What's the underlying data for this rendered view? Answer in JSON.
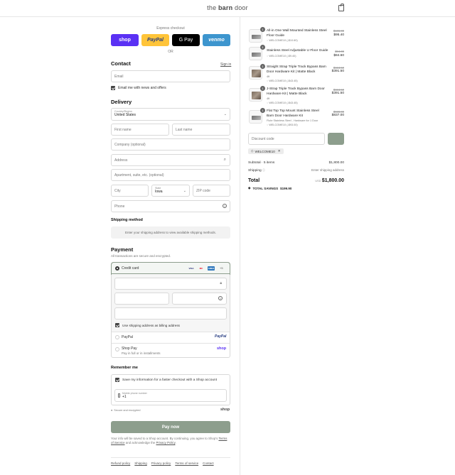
{
  "header": {
    "brand_pre": "the ",
    "brand_bold": "barn",
    "brand_post": " door",
    "cart_icon": "shopping-bag-icon"
  },
  "express": {
    "label": "Express checkout",
    "buttons": [
      "shop",
      "PayPal",
      "G Pay",
      "venmo"
    ],
    "or": "OR"
  },
  "contact": {
    "title": "Contact",
    "sign_in": "Sign in",
    "email_placeholder": "Email",
    "newsletter_label": "Email me with news and offers"
  },
  "delivery": {
    "title": "Delivery",
    "country_label": "Country/Region",
    "country_value": "United States",
    "first_name": "First name",
    "last_name": "Last name",
    "company": "Company (optional)",
    "address": "Address",
    "apartment": "Apartment, suite, etc. (optional)",
    "city": "City",
    "state_label": "State",
    "state_value": "Iowa",
    "zip": "ZIP code",
    "phone": "Phone"
  },
  "shipping_method": {
    "title": "Shipping method",
    "info": "Enter your shipping address to view available shipping methods."
  },
  "payment": {
    "title": "Payment",
    "subtitle": "All transactions are secure and encrypted.",
    "credit_card_label": "Credit card",
    "card_brands": [
      "VISA",
      "MC",
      "AMEX"
    ],
    "more_brands": "+5",
    "billing_same": "Use shipping address as billing address",
    "paypal_label": "PayPal",
    "paypal_logo": "PayPal",
    "shoppay_label": "Shop Pay",
    "shoppay_sub": "Pay in full or in installments",
    "shoppay_logo": "shop"
  },
  "remember": {
    "title": "Remember me",
    "save_label": "Save my information for a faster checkout with a Shop account",
    "phone_label": "Mobile phone number",
    "phone_value": "+1",
    "secure": "Secure and encrypted",
    "shop_logo": "shop"
  },
  "paynow": {
    "label": "Pay now"
  },
  "legal": {
    "line1": "Your info will be saved to a Shop account. By continuing, you agree to Shop's",
    "tos": "Terms of Service",
    "and": " and acknowledge the ",
    "privacy": "Privacy Policy",
    "end": "."
  },
  "footer": [
    "Refund policy",
    "Shipping",
    "Privacy policy",
    "Terms of service",
    "Contact"
  ],
  "cart": {
    "items": [
      {
        "qty": "1",
        "name": "All-in One Wall Mounted Stainless Steel Floor Guide",
        "variant": "",
        "discount": "WELCOME10 (-$10.60)",
        "old": "$106.00",
        "price": "$95.40"
      },
      {
        "qty": "1",
        "name": "Stainless Steel Adjustable U Floor Guide",
        "variant": "",
        "discount": "WELCOME10 (-$9.40)",
        "old": "$94.00",
        "price": "$84.60"
      },
      {
        "qty": "1",
        "name": "Straight Strap Triple Track Bypass Barn Door Hardware Kit | Matte Black",
        "variant": "4ft",
        "discount": "WELCOME10 (-$43.45)",
        "old": "$434.50",
        "price": "$391.50"
      },
      {
        "qty": "1",
        "name": "J-Strap Triple Track Bypass Barn Door Hardware Kit | Matte Black",
        "variant": "4ft",
        "discount": "WELCOME10 (-$43.45)",
        "old": "$434.50",
        "price": "$391.50"
      },
      {
        "qty": "1",
        "name": "Flat Top Top Mount Stainless Steel Barn Door Hardware Kit",
        "variant": "Flute Stainless Steel - Hardware for 1 Door",
        "discount": "WELCOME10 (-$93.00)",
        "old": "$930.00",
        "price": "$837.00"
      }
    ],
    "discount_placeholder": "Discount code",
    "applied_code": "WELCOME10",
    "subtotal_label": "Subtotal · 5 items",
    "subtotal_value": "$1,800.00",
    "shipping_label": "Shipping",
    "shipping_value": "Enter shipping address",
    "total_label": "Total",
    "currency": "USD",
    "total_value": "$1,800.00",
    "savings_label": "TOTAL SAVINGS",
    "savings_value": "$199.90"
  },
  "colors": {
    "accent": "#8d9e8d",
    "shop": "#5a31f4",
    "paypal": "#ffc439",
    "venmo": "#3d95ce"
  }
}
